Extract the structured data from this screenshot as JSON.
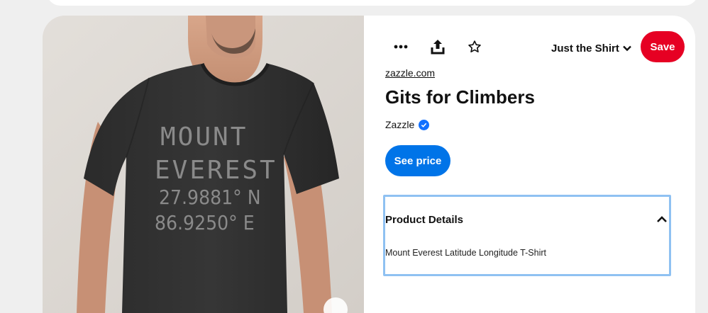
{
  "pin": {
    "image_alt": "Black t-shirt printed with Mount Everest coordinates",
    "shirt_print": {
      "line1": "MOUNT",
      "line2": "EVEREST",
      "line3": "27.9881° N",
      "line4": "86.9250° E"
    },
    "toolbar": {
      "more_icon": "more-dots-icon",
      "share_icon": "share-upload-icon",
      "favorite_icon": "star-outline-icon",
      "board_name": "Just the Shirt",
      "board_chevron_icon": "chevron-down-icon",
      "save_label": "Save"
    },
    "source": "zazzle.com",
    "title": "Gits for Climbers",
    "creator": {
      "name": "Zazzle",
      "verified_icon": "verified-check-icon"
    },
    "price_label": "See price",
    "product_details": {
      "heading": "Product Details",
      "toggle_icon": "chevron-up-icon",
      "description": "Mount Everest Latitude Longitude T-Shirt"
    }
  },
  "colors": {
    "save": "#e60023",
    "price": "#0074e8",
    "focus_outline": "#8fc1f2",
    "verified": "#1170ff"
  }
}
